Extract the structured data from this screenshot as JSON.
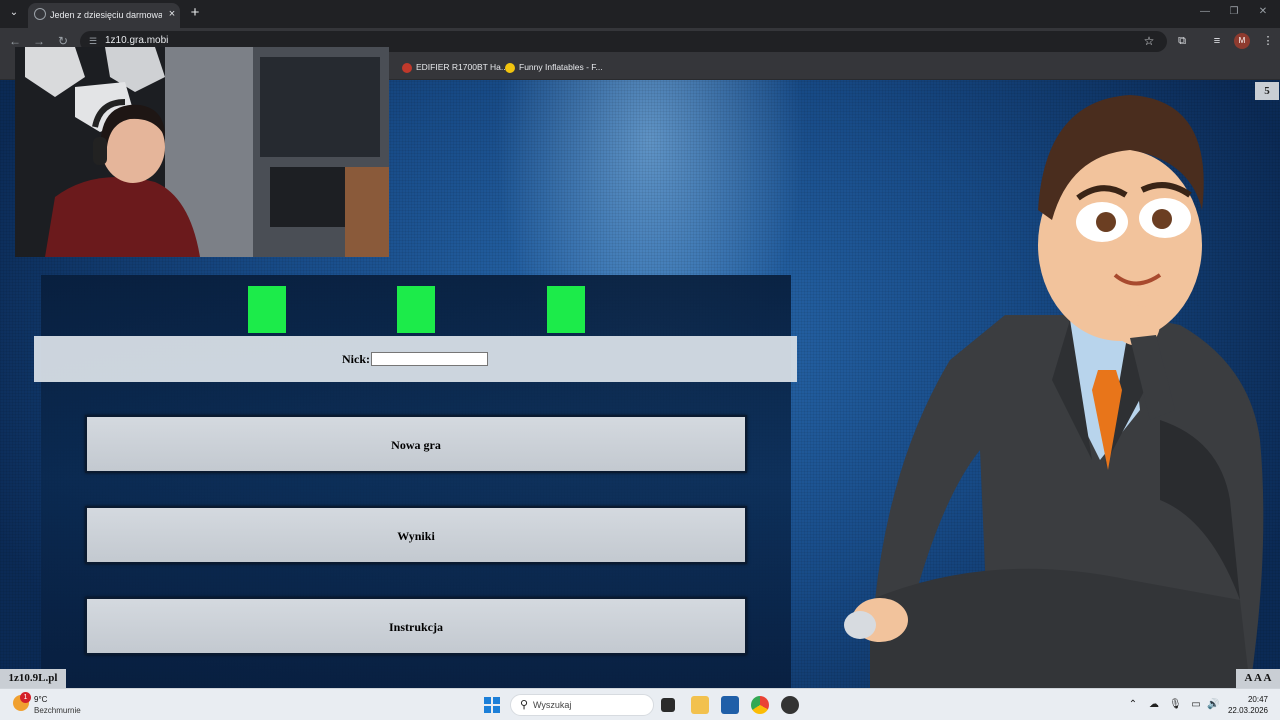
{
  "browser": {
    "tab_title": "Jeden z dziesięciu darmowa gra",
    "tab_close": "×",
    "new_tab": "+",
    "url": "1z10.gra.mobi",
    "bookmarks": [
      {
        "label": "EDIFIER R1700BT Ha...",
        "icon_color": "#c0392b"
      },
      {
        "label": "Funny Inflatables - F...",
        "icon_color": "#f1c40f"
      }
    ],
    "profile_initial": "M"
  },
  "game": {
    "counter": "5",
    "lives": 3,
    "life_color": "#1ceb4a",
    "nick_label": "Nick:",
    "nick_value": "",
    "buttons": {
      "new_game": "Nowa gra",
      "results": "Wyniki",
      "instructions": "Instrukcja"
    },
    "footer_left": "1z10.9L.pl",
    "footer_right": "A A A"
  },
  "taskbar": {
    "temperature": "9°C",
    "weather": "Bezchmurnie",
    "weather_badge": "1",
    "search_placeholder": "Wyszukaj",
    "time": "20:47",
    "date": "22.03.2026"
  },
  "icons": {
    "tab_list": "chevron-down-icon",
    "back": "arrow-left-icon",
    "forward": "arrow-right-icon",
    "reload": "reload-icon",
    "site_info": "tune-icon",
    "star": "star-icon",
    "extensions": "puzzle-icon",
    "media": "queue-icon",
    "menu": "kebab-menu-icon"
  }
}
